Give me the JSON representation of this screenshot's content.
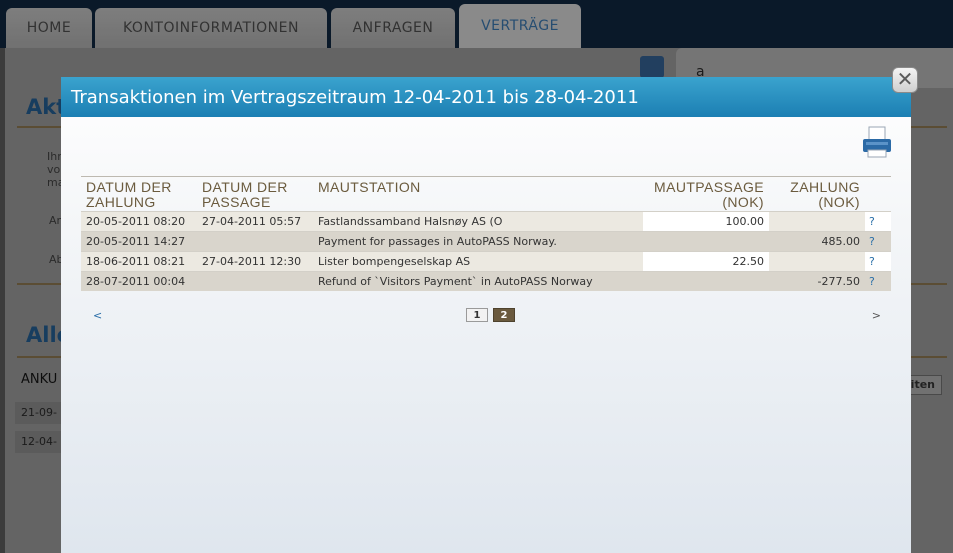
{
  "nav": {
    "tabs": [
      {
        "label": "HOME"
      },
      {
        "label": "KONTOINFORMATIONEN"
      },
      {
        "label": "ANFRAGEN"
      },
      {
        "label": "VERTRÄGE"
      }
    ]
  },
  "background": {
    "heading1": "Akt",
    "intro_lines": [
      "Ihr",
      "vo",
      "ma"
    ],
    "label_an": "An",
    "label_ab": "Ab",
    "heading2": "Alle",
    "list_header": "ANKU",
    "rows": [
      "21-09-",
      "12-04-"
    ],
    "button_label": "iten",
    "sub_tab_char": "a"
  },
  "modal": {
    "title": "Transaktionen im Vertragszeitraum 12-04-2011 bis 28-04-2011",
    "close_symbol": "✕",
    "columns": {
      "payment_date_1": "DATUM DER",
      "payment_date_2": "ZAHLUNG",
      "passage_date_1": "DATUM DER",
      "passage_date_2": "PASSAGE",
      "toll_station": "MAUTSTATION",
      "toll_passage_1": "MAUTPASSAGE",
      "toll_passage_2": "(NOK)",
      "payment_1": "ZAHLUNG",
      "payment_2": "(NOK)"
    },
    "rows": [
      {
        "payment_date": "20-05-2011 08:20",
        "passage_date": "27-04-2011 05:57",
        "station": "Fastlandssamband Halsnøy AS (O",
        "toll": "100.00",
        "payment": "",
        "help": "?"
      },
      {
        "payment_date": "20-05-2011 14:27",
        "passage_date": "",
        "station": "Payment for passages in AutoPASS Norway.",
        "toll": "",
        "payment": "485.00",
        "help": "?"
      },
      {
        "payment_date": "18-06-2011 08:21",
        "passage_date": "27-04-2011 12:30",
        "station": "Lister bompengeselskap AS",
        "toll": "22.50",
        "payment": "",
        "help": "?"
      },
      {
        "payment_date": "28-07-2011 00:04",
        "passage_date": "",
        "station": "Refund of `Visitors Payment` in AutoPASS Norway",
        "toll": "",
        "payment": "-277.50",
        "help": "?"
      }
    ],
    "pager": {
      "prev": "<",
      "next": ">",
      "pages": [
        "1",
        "2"
      ],
      "current_page": "2"
    }
  }
}
